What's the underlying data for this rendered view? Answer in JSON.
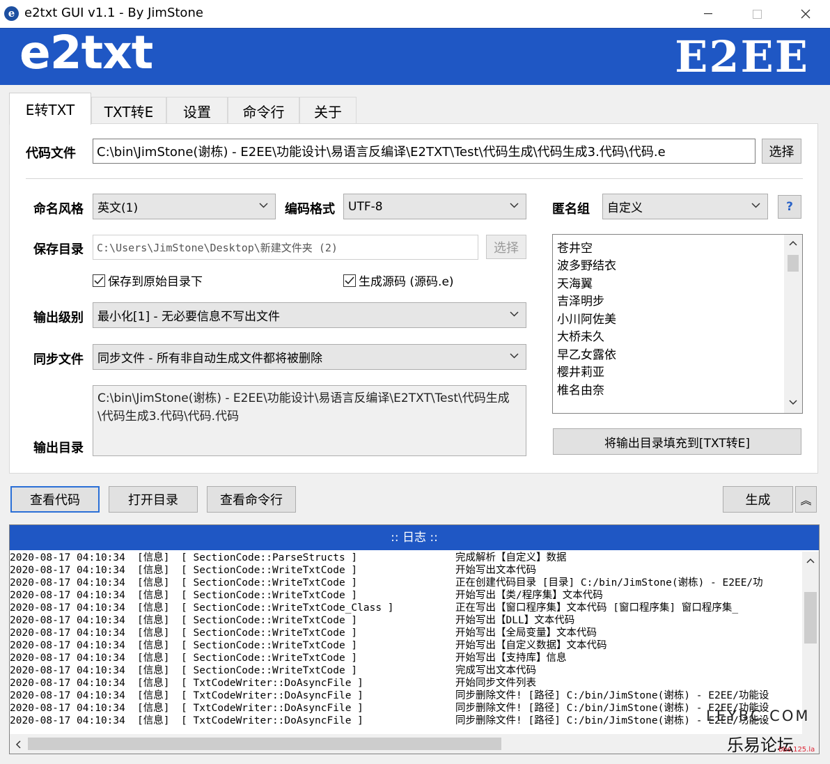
{
  "window": {
    "title": "e2txt GUI v1.1 - By JimStone",
    "icon_letter": "e"
  },
  "banner": {
    "left": "e2txt",
    "right": "E2EE"
  },
  "tabs": [
    {
      "label": "E转TXT",
      "active": true
    },
    {
      "label": "TXT转E"
    },
    {
      "label": "设置"
    },
    {
      "label": "命令行"
    },
    {
      "label": "关于"
    }
  ],
  "code_file": {
    "label": "代码文件",
    "value": "C:\\bin\\JimStone(谢栋) - E2EE\\功能设计\\易语言反编译\\E2TXT\\Test\\代码生成\\代码生成3.代码\\代码.e",
    "button": "选择"
  },
  "naming": {
    "label": "命名风格",
    "value": "英文(1)"
  },
  "encoding": {
    "label": "编码格式",
    "value": "UTF-8"
  },
  "anon_group": {
    "label": "匿名组",
    "value": "自定义",
    "help": "?"
  },
  "save_dir": {
    "label": "保存目录",
    "value": "C:\\Users\\JimStone\\Desktop\\新建文件夹 (2)",
    "button": "选择"
  },
  "checkboxes": {
    "save_original": "保存到原始目录下",
    "gen_source": "生成源码 (源码.e)"
  },
  "output_level": {
    "label": "输出级别",
    "value": "最小化[1] - 无必要信息不写出文件"
  },
  "sync_file": {
    "label": "同步文件",
    "value": "同步文件 - 所有非自动生成文件都将被删除"
  },
  "output_dir": {
    "label": "输出目录",
    "value": "C:\\bin\\JimStone(谢栋) - E2EE\\功能设计\\易语言反编译\\E2TXT\\Test\\代码生成\\代码生成3.代码\\代码.代码"
  },
  "anon_list": [
    "苍井空",
    "波多野结衣",
    "天海翼",
    "吉泽明步",
    "小川阿佐美",
    "大桥未久",
    "早乙女露依",
    "樱井莉亚",
    "椎名由奈"
  ],
  "fill_button": "将输出目录填充到[TXT转E]",
  "actions": {
    "view_code": "查看代码",
    "open_dir": "打开目录",
    "view_cmd": "查看命令行",
    "generate": "生成",
    "collapse": "︽"
  },
  "log": {
    "header": ":: 日志 ::",
    "lines": [
      {
        "time": "2020-08-17 04:10:34",
        "level": "[信息]",
        "source": "[ SectionCode::ParseStructs ]",
        "msg": "完成解析【自定义】数据"
      },
      {
        "time": "2020-08-17 04:10:34",
        "level": "[信息]",
        "source": "[ SectionCode::WriteTxtCode ]",
        "msg": "开始写出文本代码"
      },
      {
        "time": "2020-08-17 04:10:34",
        "level": "[信息]",
        "source": "[ SectionCode::WriteTxtCode ]",
        "msg": "正在创建代码目录 [目录] C:/bin/JimStone(谢栋) - E2EE/功"
      },
      {
        "time": "2020-08-17 04:10:34",
        "level": "[信息]",
        "source": "[ SectionCode::WriteTxtCode ]",
        "msg": "开始写出【类/程序集】文本代码"
      },
      {
        "time": "2020-08-17 04:10:34",
        "level": "[信息]",
        "source": "[ SectionCode::WriteTxtCode_Class ]",
        "msg": "正在写出【窗口程序集】文本代码 [窗口程序集] 窗口程序集_"
      },
      {
        "time": "2020-08-17 04:10:34",
        "level": "[信息]",
        "source": "[ SectionCode::WriteTxtCode ]",
        "msg": "开始写出【DLL】文本代码"
      },
      {
        "time": "2020-08-17 04:10:34",
        "level": "[信息]",
        "source": "[ SectionCode::WriteTxtCode ]",
        "msg": "开始写出【全局变量】文本代码"
      },
      {
        "time": "2020-08-17 04:10:34",
        "level": "[信息]",
        "source": "[ SectionCode::WriteTxtCode ]",
        "msg": "开始写出【自定义数据】文本代码"
      },
      {
        "time": "2020-08-17 04:10:34",
        "level": "[信息]",
        "source": "[ SectionCode::WriteTxtCode ]",
        "msg": "开始写出【支持库】信息"
      },
      {
        "time": "2020-08-17 04:10:34",
        "level": "[信息]",
        "source": "[ SectionCode::WriteTxtCode ]",
        "msg": "完成写出文本代码"
      },
      {
        "time": "2020-08-17 04:10:34",
        "level": "[信息]",
        "source": "[ TxtCodeWriter::DoAsyncFile ]",
        "msg": "开始同步文件列表"
      },
      {
        "time": "2020-08-17 04:10:34",
        "level": "[信息]",
        "source": "[ TxtCodeWriter::DoAsyncFile ]",
        "msg": "同步删除文件! [路径] C:/bin/JimStone(谢栋) - E2EE/功能设"
      },
      {
        "time": "2020-08-17 04:10:34",
        "level": "[信息]",
        "source": "[ TxtCodeWriter::DoAsyncFile ]",
        "msg": "同步删除文件! [路径] C:/bin/JimStone(谢栋) - E2EE/功能设"
      },
      {
        "time": "2020-08-17 04:10:34",
        "level": "[信息]",
        "source": "[ TxtCodeWriter::DoAsyncFile ]",
        "msg": "同步删除文件! [路径] C:/bin/JimStone(谢栋) - E2EE/功能设"
      }
    ]
  },
  "watermark": {
    "en": "LEYBC.COM",
    "cn": "乐易论坛",
    "url": "bbs.125.la"
  },
  "colors": {
    "accent": "#1f57c4",
    "panel": "#ffffff",
    "chrome": "#f0f0f0"
  }
}
